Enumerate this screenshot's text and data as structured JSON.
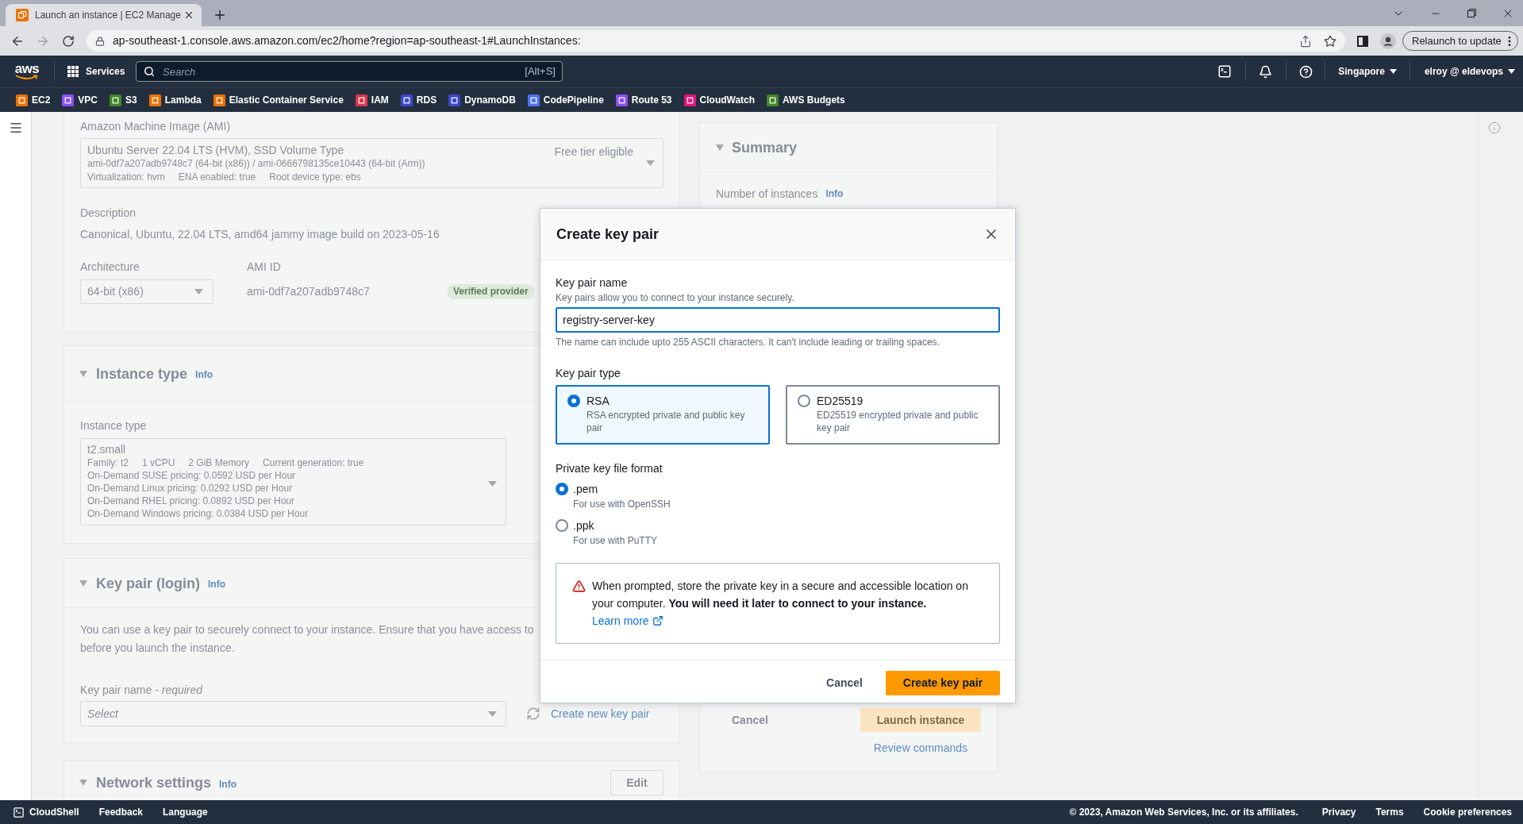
{
  "browser": {
    "tabs": [
      {
        "title": "Launch an instance | EC2 Manage",
        "selected": true
      }
    ],
    "url": "ap-southeast-1.console.aws.amazon.com/ec2/home?region=ap-southeast-1#LaunchInstances:",
    "relaunch_button": "Relaunch to update"
  },
  "top_nav": {
    "logo": "aws",
    "services": "Services",
    "search": {
      "placeholder": "Search",
      "shortcut": "[Alt+S]"
    },
    "region": "Singapore",
    "account": "elroy @ eldevops"
  },
  "favorites": [
    {
      "label": "EC2",
      "color": "#ed7100"
    },
    {
      "label": "VPC",
      "color": "#8c4fff"
    },
    {
      "label": "S3",
      "color": "#3f8624"
    },
    {
      "label": "Lambda",
      "color": "#ed7100"
    },
    {
      "label": "Elastic Container Service",
      "color": "#ed7100"
    },
    {
      "label": "IAM",
      "color": "#dd344c"
    },
    {
      "label": "RDS",
      "color": "#3b48cc"
    },
    {
      "label": "DynamoDB",
      "color": "#3b48cc"
    },
    {
      "label": "CodePipeline",
      "color": "#4d72f3"
    },
    {
      "label": "Route 53",
      "color": "#8c4fff"
    },
    {
      "label": "CloudWatch",
      "color": "#e7157b"
    },
    {
      "label": "AWS Budgets",
      "color": "#3f8624"
    }
  ],
  "ami": {
    "label": "Amazon Machine Image (AMI)",
    "name": "Ubuntu Server 22.04 LTS (HVM), SSD Volume Type",
    "free_tier": "Free tier eligible",
    "ids": "ami-0df7a207adb9748c7 (64-bit (x86)) / ami-0666798135ce10443 (64-bit (Arm))",
    "details": [
      "Virtualization: hvm",
      "ENA enabled: true",
      "Root device type: ebs"
    ],
    "description_label": "Description",
    "description": "Canonical, Ubuntu, 22.04 LTS, amd64 jammy image build on 2023-05-16",
    "architecture_label": "Architecture",
    "architecture": "64-bit (x86)",
    "ami_id_label": "AMI ID",
    "ami_id": "ami-0df7a207adb9748c7",
    "verified_badge": "Verified provider"
  },
  "instance_type": {
    "title": "Instance type",
    "info": "Info",
    "expanded": true,
    "field_label": "Instance type",
    "value": "t2.small",
    "specs": [
      "Family: t2",
      "1 vCPU",
      "2 GiB Memory",
      "Current generation: true"
    ],
    "pricing": [
      "On-Demand SUSE pricing: 0.0592 USD per Hour",
      "On-Demand Linux pricing: 0.0292 USD per Hour",
      "On-Demand RHEL pricing: 0.0892 USD per Hour",
      "On-Demand Windows pricing: 0.0384 USD per Hour"
    ]
  },
  "key_pair": {
    "title": "Key pair (login)",
    "info": "Info",
    "expanded": true,
    "description_lines": [
      "You can use a key pair to securely connect to your instance. Ensure that you have access to",
      "before you launch the instance."
    ],
    "field_label": "Key pair name - *required*",
    "placeholder": "Select",
    "create_link": "Create new key pair"
  },
  "network_settings": {
    "title": "Network settings",
    "info": "Info",
    "expanded": true,
    "edit_button": "Edit"
  },
  "summary": {
    "title": "Summary",
    "expanded": true,
    "instances_label": "Number of instances",
    "info": "Info",
    "cancel_button": "Cancel",
    "launch_button": "Launch instance",
    "review_link": "Review commands"
  },
  "modal": {
    "title": "Create key pair",
    "name_field": {
      "label": "Key pair name",
      "description": "Key pairs allow you to connect to your instance securely.",
      "value": "registry-server-key",
      "hint": "The name can include upto 255 ASCII characters. It can't include leading or trailing spaces."
    },
    "type_label": "Key pair type",
    "types": [
      {
        "label": "RSA",
        "description": "RSA encrypted private and public key pair",
        "selected": true
      },
      {
        "label": "ED25519",
        "description": "ED25519 encrypted private and public key pair",
        "selected": false
      }
    ],
    "format_label": "Private key file format",
    "formats": [
      {
        "label": ".pem",
        "description": "For use with OpenSSH",
        "selected": true
      },
      {
        "label": ".ppk",
        "description": "For use with PuTTY",
        "selected": false
      }
    ],
    "alert": {
      "text": "When prompted, store the private key in a secure and accessible location on your computer. **You will need it later to connect to your instance.**",
      "link": "Learn more"
    },
    "cancel_button": "Cancel",
    "create_button": "Create key pair"
  },
  "footer": {
    "cloudshell": "CloudShell",
    "links": [
      "Feedback",
      "Language"
    ],
    "copyright": "© 2023, Amazon Web Services, Inc. or its affiliates.",
    "legal_links": [
      "Privacy",
      "Terms",
      "Cookie preferences"
    ]
  }
}
